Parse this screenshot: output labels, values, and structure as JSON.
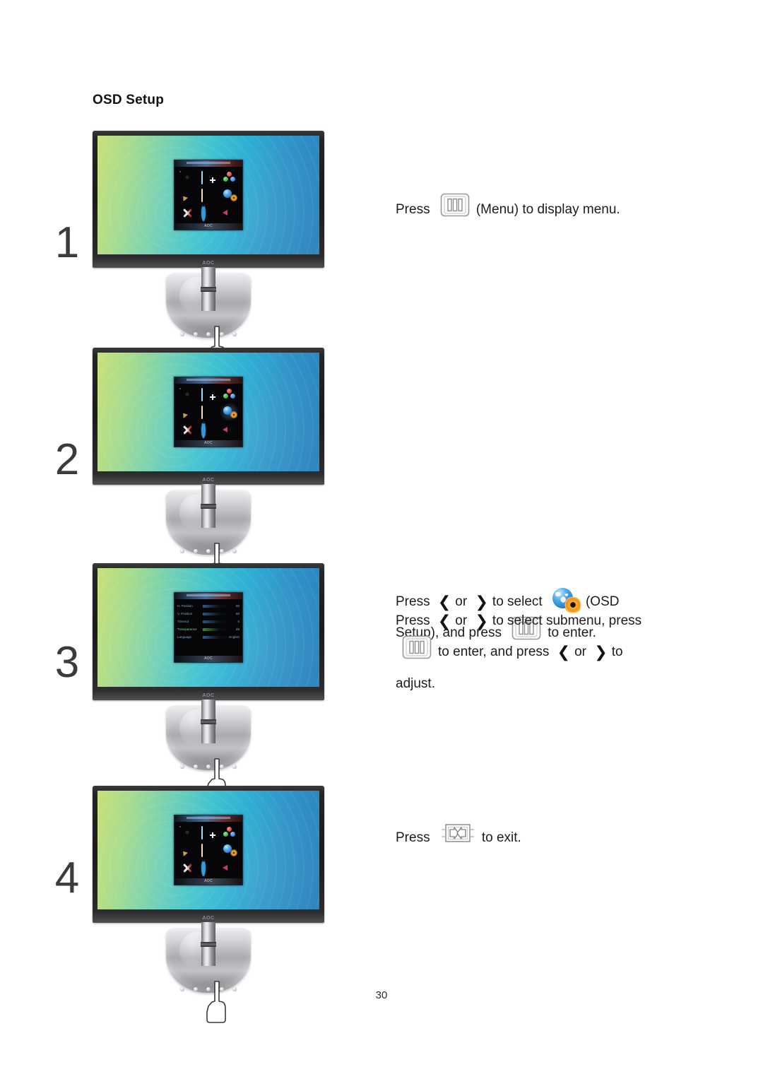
{
  "document": {
    "heading": "OSD Setup",
    "page_number": "30"
  },
  "osd_menu": {
    "title_label": "OSD Setup",
    "brand_label": "AOC",
    "icons": [
      {
        "name": "luminance-icon",
        "label": "Luminance"
      },
      {
        "name": "image-setup-icon",
        "label": "Image Setup"
      },
      {
        "name": "color-setup-icon",
        "label": "Color Setup"
      },
      {
        "name": "boost-icon",
        "label": "Boost"
      },
      {
        "name": "picture-boost-icon",
        "label": "Picture Boost"
      },
      {
        "name": "osd-setup-icon",
        "label": "OSD Setup"
      },
      {
        "name": "extra-icon",
        "label": "Extra"
      },
      {
        "name": "reset-icon",
        "label": "Reset"
      },
      {
        "name": "exit-icon",
        "label": "Exit"
      }
    ]
  },
  "submenu": {
    "rows": [
      {
        "label": "H. Position",
        "value": "50"
      },
      {
        "label": "V. Position",
        "value": "50"
      },
      {
        "label": "Timeout",
        "value": "5"
      },
      {
        "label": "Transparence",
        "value": "25"
      },
      {
        "label": "Language",
        "value": "English"
      }
    ]
  },
  "steps": [
    {
      "number": "1",
      "selected_icon_index": -1,
      "monitor_mode": "grid",
      "lines": [
        [
          {
            "type": "text",
            "value": "Press"
          },
          {
            "type": "key",
            "value": "menu-button-icon"
          },
          {
            "type": "text",
            "value": "(Menu) to display menu."
          }
        ]
      ]
    },
    {
      "number": "2",
      "selected_icon_index": 5,
      "monitor_mode": "grid",
      "lines": [
        [
          {
            "type": "text",
            "value": "Press"
          },
          {
            "type": "arrow",
            "value": "left-arrow-icon"
          },
          {
            "type": "text",
            "value": "or"
          },
          {
            "type": "arrow",
            "value": "right-arrow-icon"
          },
          {
            "type": "text",
            "value": "to select"
          },
          {
            "type": "chip",
            "value": "osd-setup-chip-icon"
          },
          {
            "type": "text",
            "value": "(OSD"
          }
        ],
        [
          {
            "type": "text",
            "value": "Setup), and press"
          },
          {
            "type": "key",
            "value": "menu-button-icon"
          },
          {
            "type": "text",
            "value": "to enter."
          }
        ]
      ]
    },
    {
      "number": "3",
      "selected_icon_index": -1,
      "monitor_mode": "submenu",
      "lines": [
        [
          {
            "type": "text",
            "value": "Press"
          },
          {
            "type": "arrow",
            "value": "left-arrow-icon"
          },
          {
            "type": "text",
            "value": "or"
          },
          {
            "type": "arrow",
            "value": "right-arrow-icon"
          },
          {
            "type": "text",
            "value": "to select submenu, press"
          }
        ],
        [
          {
            "type": "key",
            "value": "menu-button-icon"
          },
          {
            "type": "text",
            "value": "to enter, and press"
          },
          {
            "type": "arrow",
            "value": "left-arrow-icon"
          },
          {
            "type": "text",
            "value": "or"
          },
          {
            "type": "arrow",
            "value": "right-arrow-icon"
          },
          {
            "type": "text",
            "value": "to"
          }
        ],
        [
          {
            "type": "text",
            "value": "adjust."
          }
        ]
      ]
    },
    {
      "number": "4",
      "selected_icon_index": -1,
      "monitor_mode": "grid",
      "lines": [
        [
          {
            "type": "text",
            "value": "Press"
          },
          {
            "type": "key",
            "value": "exit-button-icon"
          },
          {
            "type": "text",
            "value": "to exit."
          }
        ]
      ]
    }
  ],
  "glyphs": {
    "left_arrow": "❮",
    "right_arrow": "❯"
  },
  "colors": {
    "screen_left": "#c9e07a",
    "screen_mid": "#3cc2cf",
    "screen_right": "#2a7fbd",
    "bezel": "#1b1b1d",
    "stand": "#a9a9b0",
    "accent_gear": "#ef8d16",
    "accent_globe": "#1f74c4"
  }
}
